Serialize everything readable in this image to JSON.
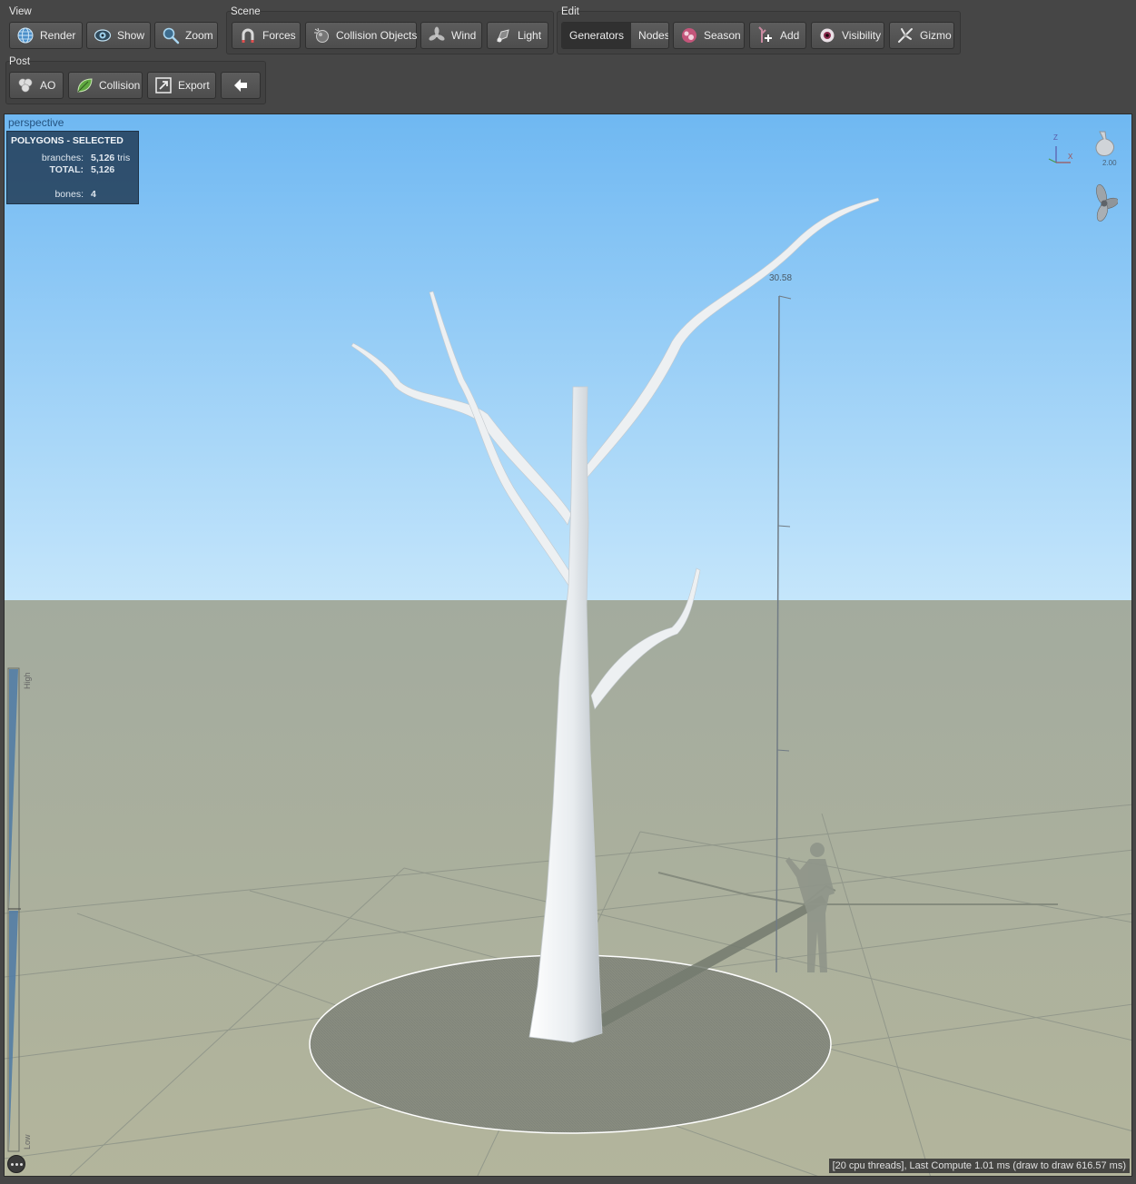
{
  "toolbar": {
    "view": {
      "label": "View",
      "render": "Render",
      "show": "Show",
      "zoom": "Zoom"
    },
    "scene": {
      "label": "Scene",
      "forces": "Forces",
      "collision_objects": "Collision Objects",
      "wind": "Wind",
      "light": "Light"
    },
    "edit": {
      "label": "Edit",
      "generators": "Generators",
      "nodes": "Nodes",
      "season": "Season",
      "add": "Add",
      "visibility": "Visibility",
      "gizmo": "Gizmo",
      "active_mode": "Generators"
    },
    "post": {
      "label": "Post",
      "ao": "AO",
      "collision": "Collision",
      "export": "Export"
    }
  },
  "viewport": {
    "camera": "perspective",
    "stats": {
      "header": "POLYGONS - SELECTED",
      "branches_label": "branches:",
      "branches_value": "5,126",
      "branches_unit": "tris",
      "total_label": "TOTAL:",
      "total_value": "5,126",
      "bones_label": "bones:",
      "bones_value": "4"
    },
    "height_marker": "30.58",
    "light_zoom": "2.00",
    "axis_z": "Z",
    "axis_x": "X",
    "lod_high": "High",
    "lod_low": "Low",
    "status": "[20 cpu threads], Last Compute 1.01 ms (draw to draw 616.57 ms)"
  },
  "colors": {
    "sky_top": "#6fb8f2",
    "sky_horizon": "#c5e6fb",
    "ground": "#aab0a0",
    "tree": "#e9edf0",
    "toolbar_bg": "#464646",
    "stats_bg": "#1e3750"
  },
  "icons": [
    "globe-icon",
    "eye-icon",
    "magnifier-icon",
    "magnet-icon",
    "collision-icon",
    "fan-icon",
    "lamp-icon",
    "season-icon",
    "add-branch-icon",
    "visibility-eye-icon",
    "gizmo-icon",
    "ao-icon",
    "leaf-icon",
    "export-icon",
    "back-arrow-icon",
    "lightbulb-icon",
    "fan-widget-icon"
  ]
}
